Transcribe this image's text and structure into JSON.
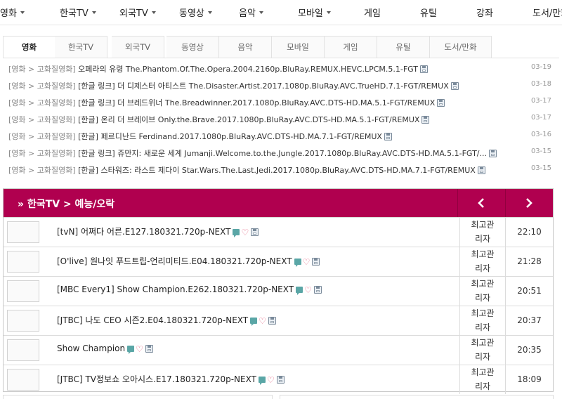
{
  "top_nav": [
    {
      "label": "영화",
      "caret": true
    },
    {
      "label": "한국TV",
      "caret": true
    },
    {
      "label": "외국TV",
      "caret": true
    },
    {
      "label": "동영상",
      "caret": true
    },
    {
      "label": "음악",
      "caret": true
    },
    {
      "label": "모바일",
      "caret": true
    },
    {
      "label": "게임",
      "caret": false
    },
    {
      "label": "유틸",
      "caret": false
    },
    {
      "label": "강좌",
      "caret": false
    },
    {
      "label": "도서/만화",
      "caret": false
    }
  ],
  "tabs": [
    {
      "label": "영화",
      "active": true
    },
    {
      "label": "한국TV"
    },
    {
      "label": "외국TV"
    },
    {
      "label": "동영상"
    },
    {
      "label": "음악"
    },
    {
      "label": "모바일"
    },
    {
      "label": "게임"
    },
    {
      "label": "유틸"
    },
    {
      "label": "도서/만화"
    }
  ],
  "movie_list": [
    {
      "category": "[영화 > 고화질영화]",
      "title": "오페라의 유령 The.Phantom.Of.The.Opera.2004.2160p.BluRay.REMUX.HEVC.LPCM.5.1-FGT",
      "date": "03-19"
    },
    {
      "category": "[영화 > 고화질영화]",
      "title": "[한글 링크] 더 디제스터 아티스트 The.Disaster.Artist.2017.1080p.BluRay.AVC.TrueHD.7.1-FGT/REMUX",
      "date": "03-18"
    },
    {
      "category": "[영화 > 고화질영화]",
      "title": "[한글 링크] 더 브레드위너 The.Breadwinner.2017.1080p.BluRay.AVC.DTS-HD.MA.5.1-FGT/REMUX",
      "date": "03-17"
    },
    {
      "category": "[영화 > 고화질영화]",
      "title": "[한글] 온리 더 브레이브 Only.the.Brave.2017.1080p.BluRay.AVC.DTS-HD.MA.5.1-FGT/REMUX",
      "date": "03-17"
    },
    {
      "category": "[영화 > 고화질영화]",
      "title": "[한글] 페르디난드 Ferdinand.2017.1080p.BluRay.AVC.DTS-HD.MA.7.1-FGT/REMUX",
      "date": "03-16"
    },
    {
      "category": "[영화 > 고화질영화]",
      "title": "[한글 링크] 쥬만지: 새로운 세계 Jumanji.Welcome.to.the.Jungle.2017.1080p.BluRay.AVC.DTS-HD.MA.5.1-FGT/...",
      "date": "03-15"
    },
    {
      "category": "[영화 > 고화질영화]",
      "title": "[한글] 스타워즈: 라스트 제다이 Star.Wars.The.Last.Jedi.2017.1080p.BluRay.AVC.DTS-HD.MA.7.1-FGT/REMUX",
      "date": "03-15"
    }
  ],
  "korean_tv": {
    "header": "»  한국TV > 예능/오락",
    "rows": [
      {
        "title": "[tvN] 어쩌다 어른.E127.180321.720p-NEXT",
        "uploader_line1": "최고관",
        "uploader_line2": "리자",
        "time": "22:10"
      },
      {
        "title": "[O'live] 원나잇 푸드트립-언리미티드.E04.180321.720p-NEXT",
        "uploader_line1": "최고관",
        "uploader_line2": "리자",
        "time": "21:28"
      },
      {
        "title": "[MBC Every1] Show Champion.E262.180321.720p-NEXT",
        "uploader_line1": "최고관",
        "uploader_line2": "리자",
        "time": "20:51"
      },
      {
        "title": "[JTBC] 나도 CEO 시즌2.E04.180321.720p-NEXT",
        "uploader_line1": "최고관",
        "uploader_line2": "리자",
        "time": "20:37"
      },
      {
        "title": "Show Champion",
        "uploader_line1": "최고관",
        "uploader_line2": "리자",
        "time": "20:35"
      },
      {
        "title": "[JTBC] TV정보쇼 오아시스.E17.180321.720p-NEXT",
        "uploader_line1": "최고관",
        "uploader_line2": "리자",
        "time": "18:09"
      }
    ]
  },
  "colors": {
    "accent": "#b0004f",
    "comment_icon": "#5aa6a6",
    "heart_icon": "#e05a7a"
  }
}
